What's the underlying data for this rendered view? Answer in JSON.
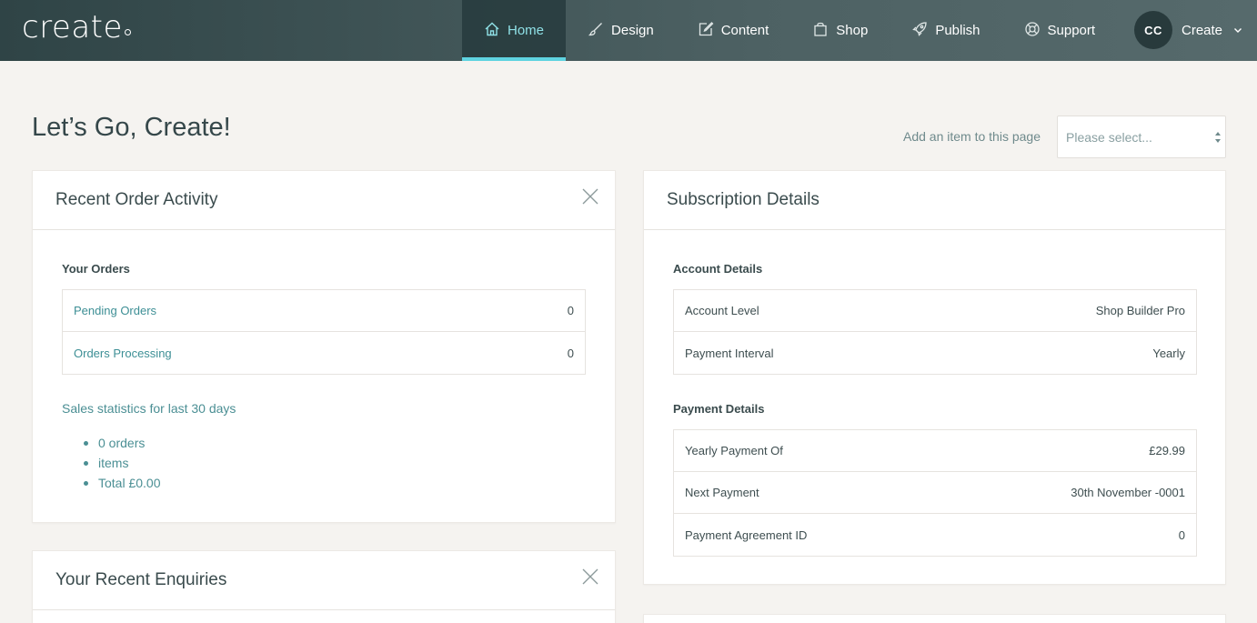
{
  "brand": {
    "logo_text": "create"
  },
  "nav": {
    "items": [
      {
        "label": "Home",
        "icon": "home-icon",
        "active": true
      },
      {
        "label": "Design",
        "icon": "brush-icon"
      },
      {
        "label": "Content",
        "icon": "edit-icon"
      },
      {
        "label": "Shop",
        "icon": "bag-icon"
      },
      {
        "label": "Publish",
        "icon": "rocket-icon"
      },
      {
        "label": "Support",
        "icon": "lifebuoy-icon"
      }
    ],
    "user": {
      "initials": "CC",
      "name": "Create"
    }
  },
  "page": {
    "title": "Let’s Go, Create!",
    "add_item_label": "Add an item to this page",
    "select_placeholder": "Please select..."
  },
  "orders_card": {
    "title": "Recent Order Activity",
    "section": "Your Orders",
    "rows": [
      {
        "label": "Pending Orders",
        "value": "0"
      },
      {
        "label": "Orders Processing",
        "value": "0"
      }
    ],
    "stats_title": "Sales statistics for last 30 days",
    "stats": [
      "0 orders",
      "items",
      "Total £0.00"
    ]
  },
  "subscription_card": {
    "title": "Subscription Details",
    "account_section": "Account Details",
    "account_rows": [
      {
        "label": "Account Level",
        "value": "Shop Builder Pro"
      },
      {
        "label": "Payment Interval",
        "value": "Yearly"
      }
    ],
    "payment_section": "Payment Details",
    "payment_rows": [
      {
        "label": "Yearly Payment Of",
        "value": "£29.99"
      },
      {
        "label": "Next Payment",
        "value": "30th November -0001"
      },
      {
        "label": "Payment Agreement ID",
        "value": "0"
      }
    ]
  },
  "enquiries_card": {
    "title": "Your Recent Enquiries"
  },
  "colors": {
    "accent": "#5fd3e0",
    "link": "#3d8f95",
    "nav_bg": "#3f5456",
    "page_bg": "#f5f3f0"
  }
}
